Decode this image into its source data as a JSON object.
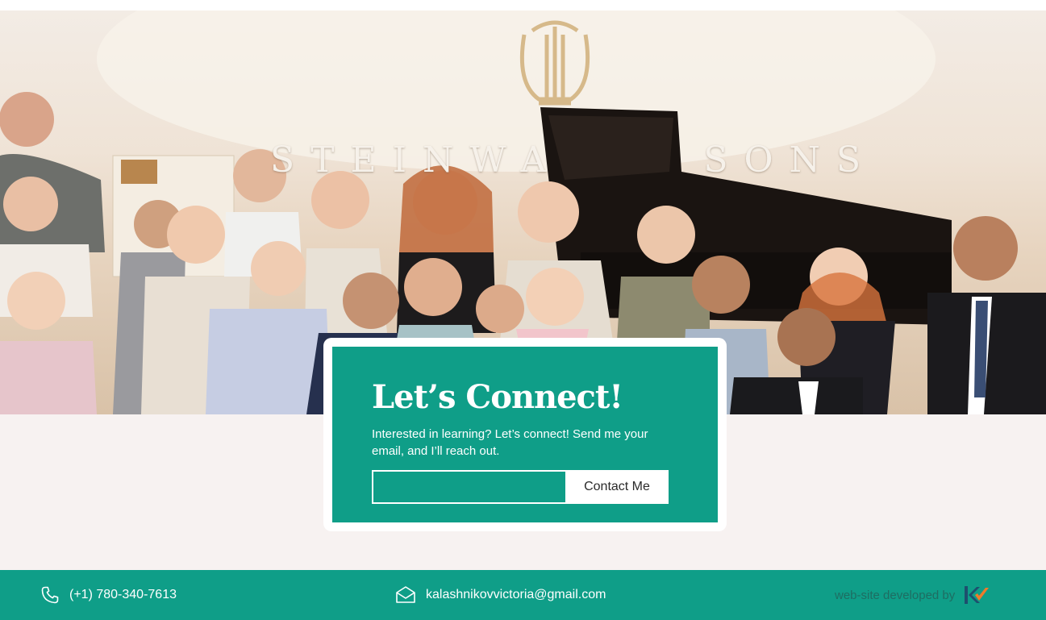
{
  "hero": {
    "brand_left": "STEINWA",
    "brand_right": "SONS"
  },
  "connect": {
    "title": "Let’s Connect!",
    "description": "Interested in learning? Let’s connect! Send me your email, and I’ll reach out.",
    "email_value": "",
    "button_label": "Contact Me"
  },
  "footer": {
    "phone": "(+1) 780-340-7613",
    "email": "kalashnikovvictoria@gmail.com",
    "credit": "web-site developed by",
    "phone_icon": "phone-icon",
    "mail_icon": "envelope-icon",
    "developer_logo": "developer-logo"
  },
  "colors": {
    "accent": "#0f9e88",
    "section_bg": "#f7f2f1",
    "logo_orange": "#f07a2a"
  }
}
